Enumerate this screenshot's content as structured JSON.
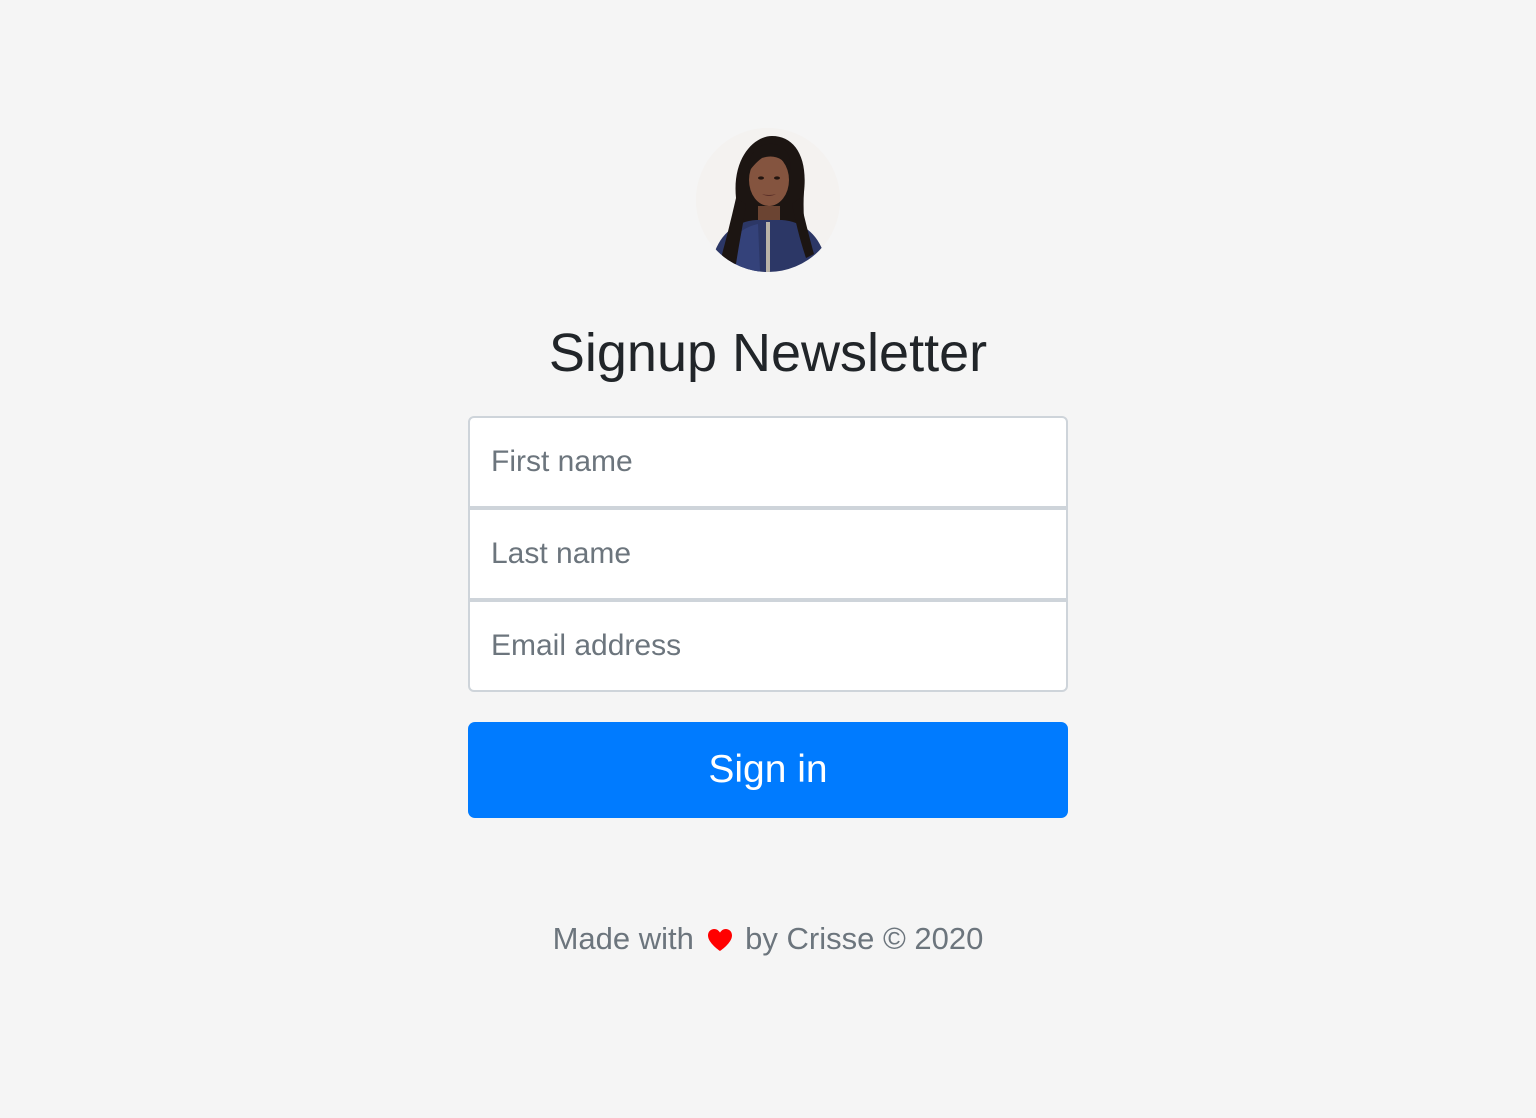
{
  "page": {
    "title": "Signup Newsletter"
  },
  "avatar": {
    "alt": "Profile photo"
  },
  "form": {
    "first_name_placeholder": "First name",
    "last_name_placeholder": "Last name",
    "email_placeholder": "Email address",
    "submit_label": "Sign in"
  },
  "footer": {
    "text_before": "Made with",
    "icon": "heart-icon",
    "text_after": "by Crisse © 2020"
  },
  "colors": {
    "background": "#f5f5f5",
    "primary": "#007bff",
    "heading": "#212529",
    "muted": "#6c757d",
    "heart": "#ff0000"
  }
}
